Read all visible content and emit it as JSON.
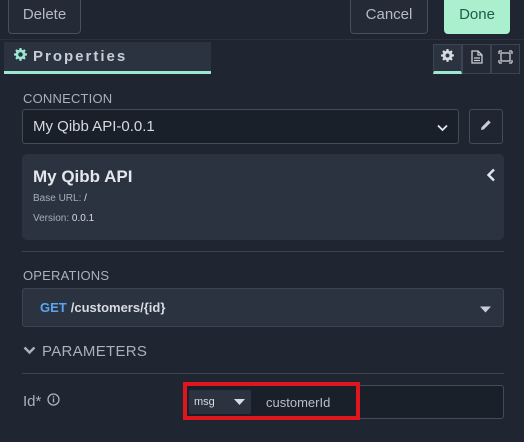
{
  "toolbar": {
    "delete_label": "Delete",
    "cancel_label": "Cancel",
    "done_label": "Done"
  },
  "tabs": {
    "properties_label": "Properties",
    "icons": [
      "gear-icon",
      "document-icon",
      "layout-icon"
    ]
  },
  "connection": {
    "section_label": "CONNECTION",
    "selected": "My Qibb API-0.0.1"
  },
  "api_card": {
    "title": "My Qibb API",
    "base_url_label": "Base URL:",
    "base_url": "/",
    "version_label": "Version:",
    "version": "0.0.1"
  },
  "operations": {
    "section_label": "OPERATIONS",
    "method": "GET",
    "path": "/customers/{id}"
  },
  "parameters": {
    "section_label": "PARAMETERS",
    "fields": [
      {
        "label": "Id*",
        "type": "msg",
        "value": "customerId"
      }
    ]
  },
  "colors": {
    "background": "#1f2631",
    "accent": "#9ce7d2",
    "done_button": "#aaf0cf",
    "method_get": "#5ba4f0",
    "highlight": "#e0161f"
  }
}
